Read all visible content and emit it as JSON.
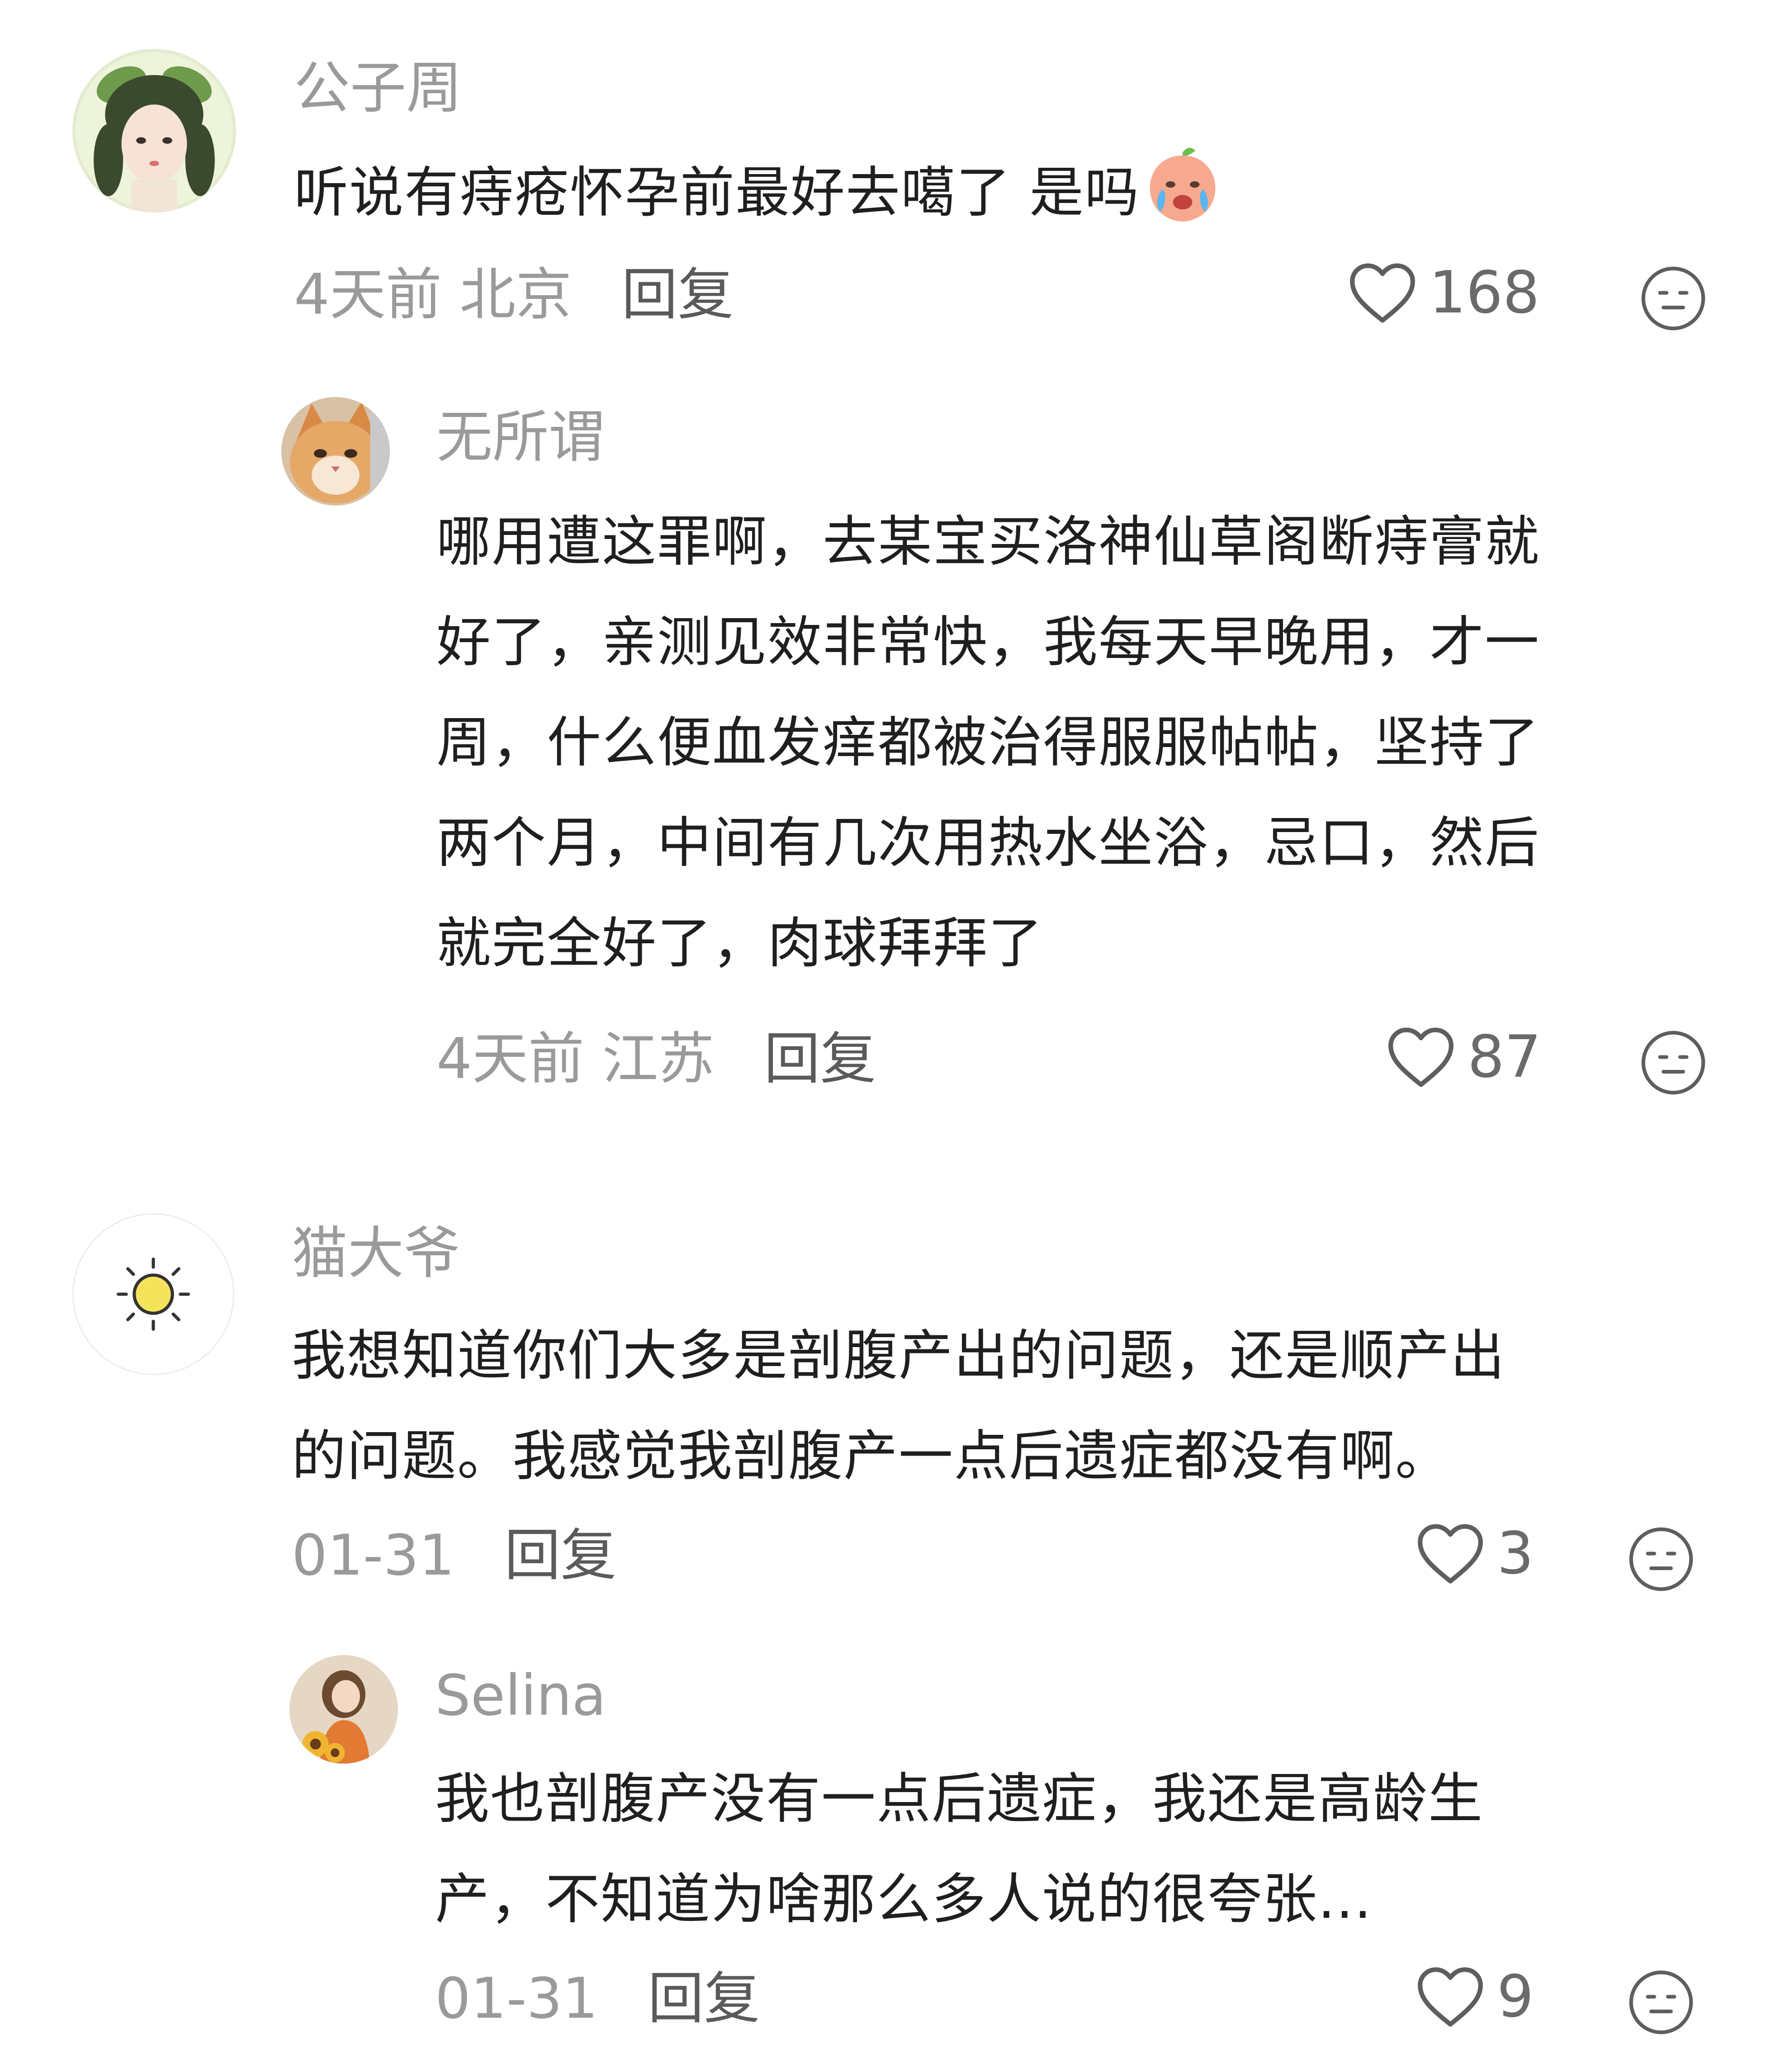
{
  "comments": [
    {
      "username": "公子周",
      "text_lines": [
        "听说有痔疮怀孕前最好去噶了 是吗"
      ],
      "emoji": "crying-peach-emoji",
      "time_location": "4天前 北京",
      "reply_label": "回复",
      "likes": "168",
      "avatar": "girl-with-leaf-headband-avatar",
      "replies": [
        {
          "username": "无所谓",
          "text_lines": [
            "哪用遭这罪啊，去某宝买洛神仙草阁断痔膏就",
            "好了，亲测见效非常快，我每天早晚用，才一",
            "周，什么便血发痒都被治得服服帖帖，坚持了",
            "两个月，中间有几次用热水坐浴，忌口，然后",
            "就完全好了，肉球拜拜了"
          ],
          "time_location": "4天前 江苏",
          "reply_label": "回复",
          "likes": "87",
          "avatar": "orange-cat-avatar"
        }
      ]
    },
    {
      "username": "猫大爷",
      "text_lines": [
        "我想知道你们大多是剖腹产出的问题，还是顺产出",
        "的问题。我感觉我剖腹产一点后遗症都没有啊。"
      ],
      "time_location": "01-31",
      "reply_label": "回复",
      "likes": "3",
      "avatar": "sun-icon-avatar",
      "replies": [
        {
          "username": "Selina",
          "text_lines": [
            "我也剖腹产没有一点后遗症，我还是高龄生",
            "产，不知道为啥那么多人说的很夸张..."
          ],
          "time_location": "01-31",
          "reply_label": "回复",
          "likes": "9",
          "avatar": "woman-with-sunflowers-avatar"
        }
      ]
    }
  ],
  "icons": {
    "like": "heart-outline-icon",
    "dislike": "neutral-face-icon"
  },
  "colors": {
    "username": "#9a9a9a",
    "text": "#1f1f1f",
    "meta": "#9a9a9a",
    "icon": "#6a6a6a"
  }
}
